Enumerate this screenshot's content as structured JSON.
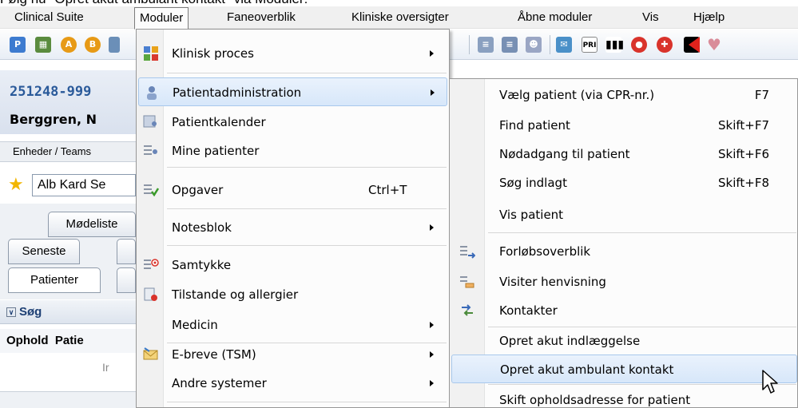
{
  "caption": "Følg nu \"Opret akut ambulant kontakt\" via Moduler:",
  "menubar": {
    "items": [
      {
        "label": "Clinical Suite"
      },
      {
        "label": "Moduler"
      },
      {
        "label": "Faneoverblik"
      },
      {
        "label": "Kliniske oversigter"
      },
      {
        "label": "Åbne moduler"
      },
      {
        "label": "Vis"
      },
      {
        "label": "Hjælp"
      }
    ]
  },
  "toolbar": {
    "icons": [
      "patient-icon",
      "calendar-icon",
      "user-a-icon",
      "user-b-icon",
      "chart-icon",
      "list-icon",
      "list-users-icon",
      "group-icon",
      "mail-icon",
      "pri-icon",
      "barcode-icon",
      "pill-icon",
      "allergy-icon",
      "flag-icon",
      "heart-icon"
    ],
    "pri_text": "PRI"
  },
  "patient": {
    "id": "251248-999",
    "name": "Berggren, N"
  },
  "units_label": "Enheder / Teams",
  "favorite_combo": "Alb Kard Se",
  "tabs": {
    "moedeliste": "Mødeliste",
    "seneste": "Seneste",
    "patienter": "Patienter"
  },
  "search": {
    "label": "Søg"
  },
  "table": {
    "columns": [
      "Ophold",
      "Patie"
    ],
    "row_text": "Ir"
  },
  "dropdown": {
    "items": [
      {
        "label": "Klinisk proces",
        "shortcut": "",
        "submenu": true
      },
      {
        "label": "Patientadministration",
        "shortcut": "",
        "submenu": true,
        "highlighted": true
      },
      {
        "label": "Patientkalender",
        "shortcut": "",
        "submenu": false
      },
      {
        "label": "Mine patienter",
        "shortcut": "",
        "submenu": false
      },
      {
        "label": "Opgaver",
        "shortcut": "Ctrl+T",
        "submenu": false
      },
      {
        "label": "Notesblok",
        "shortcut": "",
        "submenu": true
      },
      {
        "label": "Samtykke",
        "shortcut": "",
        "submenu": false
      },
      {
        "label": "Tilstande og allergier",
        "shortcut": "",
        "submenu": false
      },
      {
        "label": "Medicin",
        "shortcut": "",
        "submenu": true
      },
      {
        "label": "E-breve (TSM)",
        "shortcut": "",
        "submenu": true
      },
      {
        "label": "Andre systemer",
        "shortcut": "",
        "submenu": true
      }
    ]
  },
  "submenu": {
    "items": [
      {
        "label": "Vælg patient (via CPR-nr.)",
        "shortcut": "F7"
      },
      {
        "label": "Find patient",
        "shortcut": "Skift+F7"
      },
      {
        "label": "Nødadgang til patient",
        "shortcut": "Skift+F6"
      },
      {
        "label": "Søg indlagt",
        "shortcut": "Skift+F8"
      },
      {
        "label": "Vis patient",
        "shortcut": ""
      },
      {
        "label": "Forløbsoverblik",
        "shortcut": ""
      },
      {
        "label": "Visiter henvisning",
        "shortcut": ""
      },
      {
        "label": "Kontakter",
        "shortcut": ""
      },
      {
        "label": "Opret akut indlæggelse",
        "shortcut": ""
      },
      {
        "label": "Opret akut ambulant kontakt",
        "shortcut": "",
        "highlighted": true
      },
      {
        "label": "Skift opholdsadresse for patient",
        "shortcut": ""
      }
    ]
  },
  "colors": {
    "highlight": "#d7e7fa",
    "patient_id": "#2a5a9a"
  }
}
